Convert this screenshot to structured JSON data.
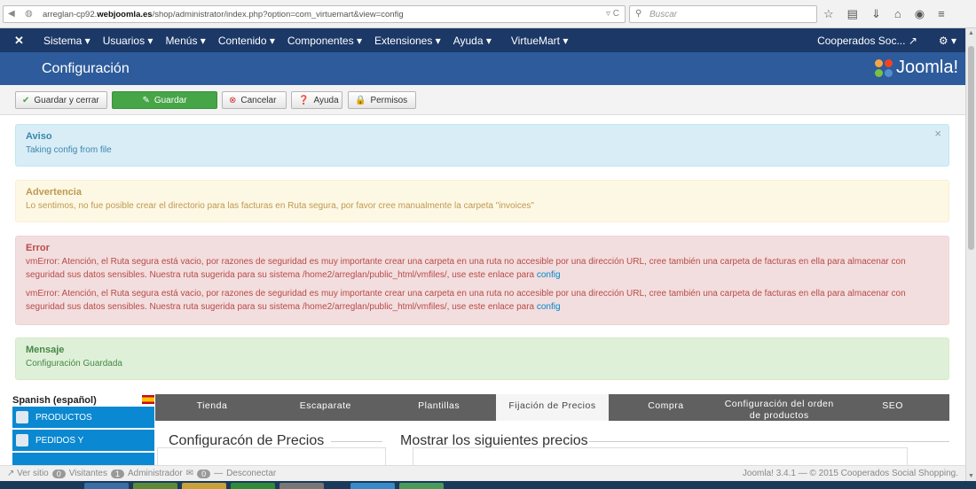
{
  "browser": {
    "url_prefix": "arreglan-cp92.",
    "url_domain": "webjoomla.es",
    "url_path": "/shop/administrator/index.php?option=com_virtuemart&view=config",
    "search_placeholder": "Buscar"
  },
  "nav": {
    "items": [
      "Sistema ▾",
      "Usuarios ▾",
      "Menús ▾",
      "Contenido ▾",
      "Componentes ▾",
      "Extensiones ▾",
      "Ayuda ▾",
      "VirtueMart ▾"
    ],
    "user": "Cooperados Soc...",
    "settings": "⚙ ▾"
  },
  "header": {
    "title": "Configuración",
    "logo": "Joomla!"
  },
  "toolbar": {
    "save_close": "Guardar y cerrar",
    "save": "Guardar",
    "cancel": "Cancelar",
    "help": "Ayuda",
    "permissions": "Permisos"
  },
  "alerts": {
    "info": {
      "title": "Aviso",
      "text": "Taking config from file"
    },
    "warning": {
      "title": "Advertencia",
      "text": "Lo sentimos, no fue posible crear el directorio para las facturas en Ruta segura, por favor cree manualmente la carpeta \"invoices\""
    },
    "error": {
      "title": "Error",
      "msg1": "vmError: Atención, el Ruta segura está vacio, por razones de seguridad es muy importante crear una carpeta en una ruta no accesible por una dirección URL, cree también una carpeta de facturas en ella para almacenar con seguridad sus datos sensibles. Nuestra ruta sugerida para su sistema /home2/arreglan/public_html/vmfiles/, use este enlace para ",
      "msg2": "vmError: Atención, el Ruta segura está vacio, por razones de seguridad es muy importante crear una carpeta en una ruta no accesible por una dirección URL, cree también una carpeta de facturas en ella para almacenar con seguridad sus datos sensibles. Nuestra ruta sugerida para su sistema /home2/arreglan/public_html/vmfiles/, use este enlace para ",
      "link": "config"
    },
    "message": {
      "title": "Mensaje",
      "text": "Configuración Guardada"
    }
  },
  "sidebar": {
    "language": "Spanish (español)",
    "items": [
      "PRODUCTOS",
      "PEDIDOS Y"
    ]
  },
  "tabs": [
    "Tienda",
    "Escaparate",
    "Plantillas",
    "Fijación de Precios",
    "Compra",
    "Configuración del orden de productos",
    "SEO"
  ],
  "panels": {
    "left_title": "Configuracón de Precios",
    "right_title": "Mostrar los siguientes precios"
  },
  "status": {
    "site": "Ver sitio",
    "visitors_count": "0",
    "visitors": "Visitantes",
    "admin_count": "1",
    "admin": "Administrador",
    "msg_count": "0",
    "logout": "Desconectar",
    "footer": "Joomla! 3.4.1 — © 2015 Cooperados Social Shopping."
  }
}
